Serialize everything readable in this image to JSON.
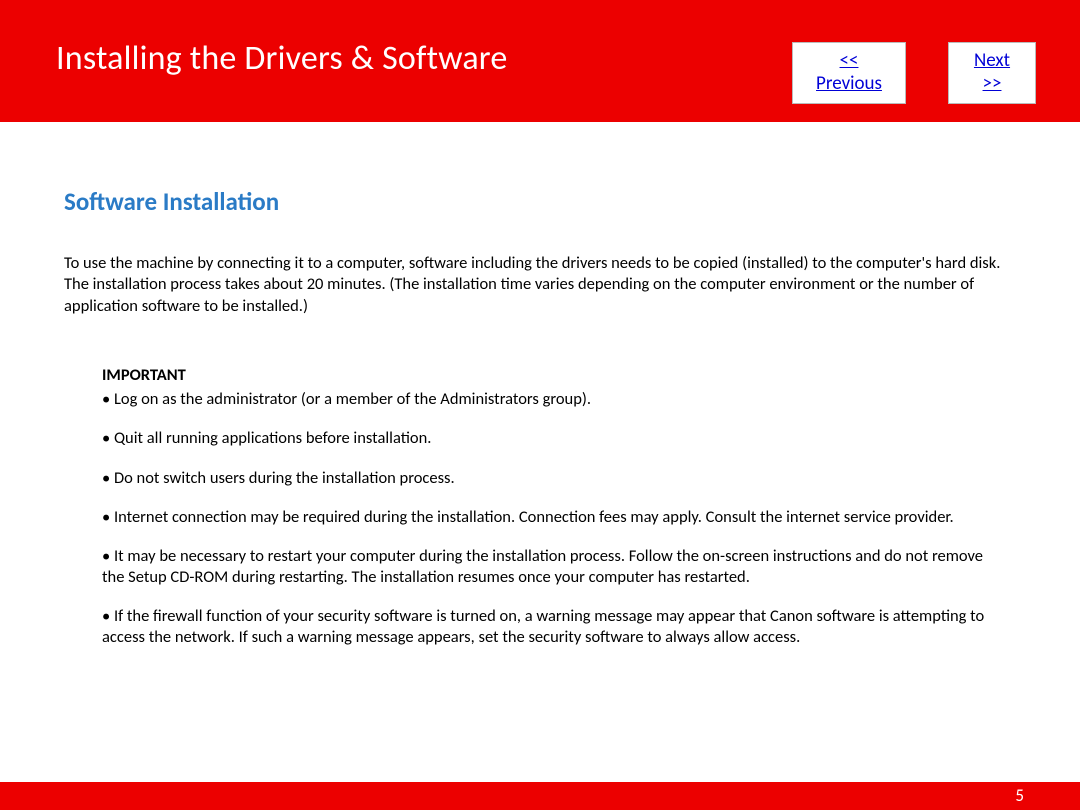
{
  "header": {
    "title": "Installing  the Drivers & Software",
    "nav": {
      "previous": "<< Previous",
      "next": "Next >>"
    }
  },
  "content": {
    "section_heading": "Software Installation",
    "intro": "To use the machine by connecting it to a computer, software including the drivers needs to be copied (installed) to the computer's hard disk. The installation process takes about 20 minutes. (The installation time varies depending on the computer environment or the number of application software to be installed.)",
    "important_label": "IMPORTANT",
    "bullets": [
      "• Log on as the administrator (or a member of the Administrators group).",
      "• Quit all running applications before installation.",
      "• Do not switch users during the installation process.",
      "• Internet connection may be required during the installation. Connection fees may apply. Consult the internet service provider.",
      "• It may be necessary to restart your computer during the installation process. Follow the on-screen instructions and do not remove the Setup CD-ROM during restarting. The installation resumes once your computer has restarted.",
      "• If the firewall function of your security software is turned on, a warning message may appear that Canon software is attempting to access the network. If such a warning message appears, set the security software to always allow access."
    ]
  },
  "footer": {
    "page_number": "5"
  }
}
